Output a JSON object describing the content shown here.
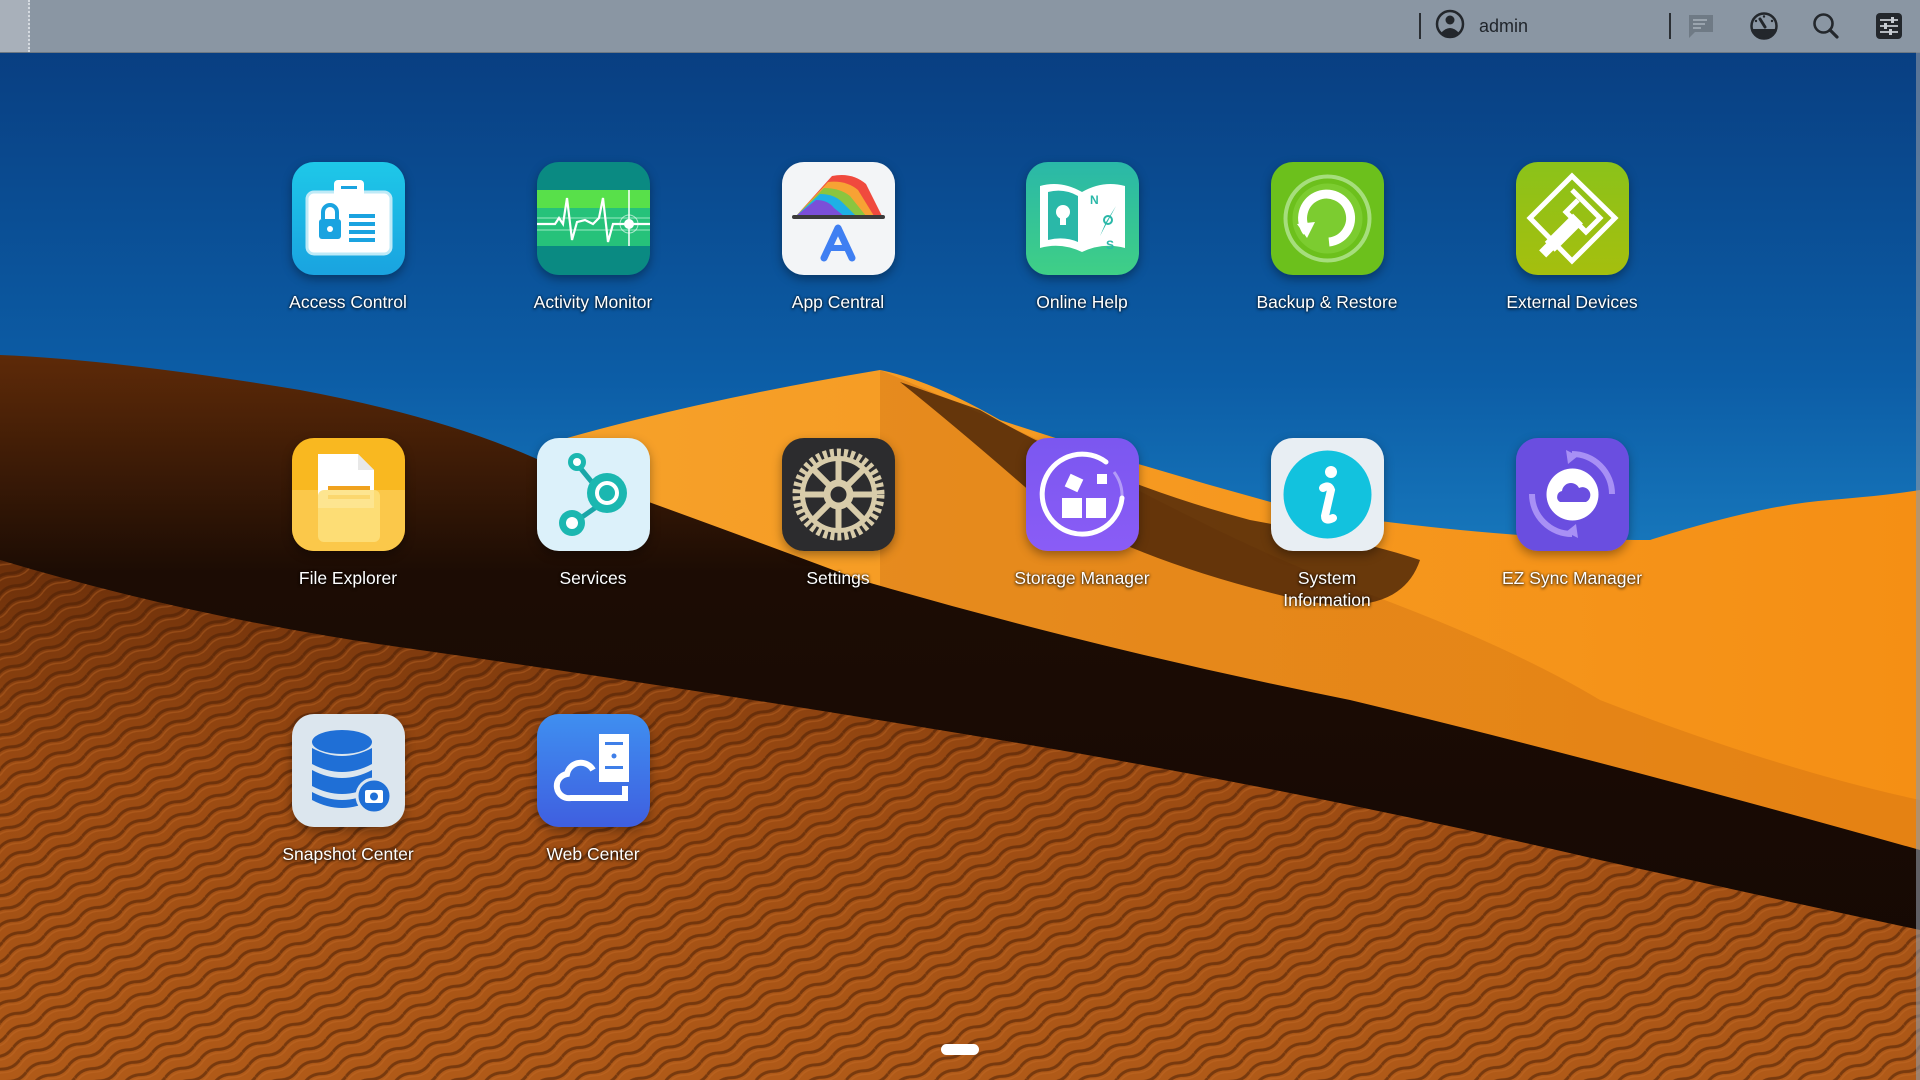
{
  "topbar": {
    "username": "admin",
    "icons": [
      "user-avatar-icon",
      "message-icon",
      "dashboard-gauge-icon",
      "search-icon",
      "settings-sliders-icon"
    ]
  },
  "apps": [
    {
      "label": "Access Control",
      "icon": "access-control-icon"
    },
    {
      "label": "Activity Monitor",
      "icon": "activity-monitor-icon"
    },
    {
      "label": "App Central",
      "icon": "app-central-icon"
    },
    {
      "label": "Online Help",
      "icon": "online-help-icon"
    },
    {
      "label": "Backup & Restore",
      "icon": "backup-restore-icon"
    },
    {
      "label": "External Devices",
      "icon": "external-devices-icon"
    },
    {
      "label": "File Explorer",
      "icon": "file-explorer-icon"
    },
    {
      "label": "Services",
      "icon": "services-icon"
    },
    {
      "label": "Settings",
      "icon": "settings-gear-icon"
    },
    {
      "label": "Storage Manager",
      "icon": "storage-manager-icon"
    },
    {
      "label": "System Information",
      "icon": "system-information-icon"
    },
    {
      "label": "EZ Sync Manager",
      "icon": "ez-sync-manager-icon"
    },
    {
      "label": "Snapshot Center",
      "icon": "snapshot-center-icon"
    },
    {
      "label": "Web Center",
      "icon": "web-center-icon"
    }
  ],
  "pager": {
    "current_page": 1,
    "total_pages": 1
  },
  "colors": {
    "topbar_bg": "#8a96a3",
    "sky_top": "#0a3f82",
    "sky_bottom": "#2b8fd0",
    "dune_light": "#f0921e",
    "dune_dark": "#8a3f0c"
  }
}
